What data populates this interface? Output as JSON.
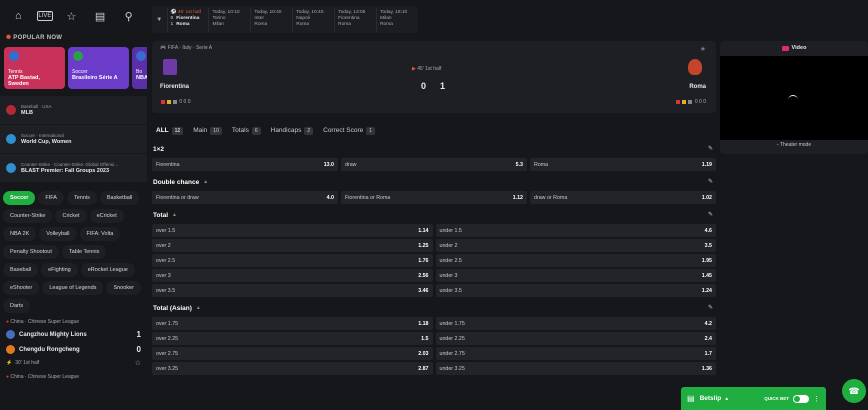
{
  "sidebar": {
    "popular_heading": "POPULAR NOW",
    "cards": [
      {
        "type": "Tennis",
        "name": "ATP Bastad, Sweden",
        "color": "#c8325a"
      },
      {
        "type": "Soccer",
        "name": "Brasileiro Série A",
        "color": "#6a3cc9"
      },
      {
        "type": "Bo",
        "name": "NBA",
        "color": "#5a2fa8"
      }
    ],
    "leagues": [
      {
        "sport": "Baseball · USA",
        "name": "MLB"
      },
      {
        "sport": "Soccer · International",
        "name": "World Cup, Women"
      },
      {
        "sport": "Counter-Strike · Counter-Strike: Global Offensi…",
        "name": "BLAST Premier: Fall Groups 2023"
      }
    ],
    "chips": [
      "Soccer",
      "FIFA",
      "Tennis",
      "Basketball",
      "Counter-Strike",
      "Cricket",
      "eCricket",
      "NBA 2K",
      "Volleyball",
      "FIFA: Volta",
      "Penalty Shootout",
      "Table Tennis",
      "Baseball",
      "eFighting",
      "eRocket League",
      "eShooter",
      "League of Legends",
      "Snooker",
      "Darts"
    ],
    "match": {
      "league": "China · Chinese Super League",
      "team1": "Cangzhou Mighty Lions",
      "score1": "1",
      "team2": "Chengdu Rongcheng",
      "score2": "0",
      "live": "30' 1st half",
      "next_league": "China · Chinese Super League"
    }
  },
  "topbar": {
    "matches": [
      {
        "time": "45' 1st half",
        "t1": "Fiorentina",
        "t2": "Roma",
        "s1": "0",
        "s2": "1",
        "live": true
      },
      {
        "time": "Today, 10:10",
        "t1": "Torino",
        "t2": "Milan",
        "live": false
      },
      {
        "time": "Today, 10:40",
        "t1": "Inter",
        "t2": "Roma",
        "live": false
      },
      {
        "time": "Today, 10:40",
        "t1": "Napoli",
        "t2": "Roma",
        "live": false
      },
      {
        "time": "Today, 13:05",
        "t1": "Fiorentina",
        "t2": "Roma",
        "live": false
      },
      {
        "time": "Today, 18:10",
        "t1": "Milan",
        "t2": "Roma",
        "live": false
      }
    ]
  },
  "hero": {
    "league": "FIFA · Italy · Serie A",
    "status": "45' 1st half",
    "team1": "Fiorentina",
    "team2": "Roma",
    "score1": "0",
    "score2": "1",
    "stats1": "0 0 0",
    "stats2": "0 0 0"
  },
  "tabs": [
    {
      "label": "ALL",
      "count": "12"
    },
    {
      "label": "Main",
      "count": "10"
    },
    {
      "label": "Totals",
      "count": "6"
    },
    {
      "label": "Handicaps",
      "count": "2"
    },
    {
      "label": "Correct Score",
      "count": "1"
    }
  ],
  "markets": {
    "m1x2": {
      "title": "1×2",
      "odds": [
        {
          "n": "Fiorentina",
          "v": "13.0"
        },
        {
          "n": "draw",
          "v": "5.3"
        },
        {
          "n": "Roma",
          "v": "1.19"
        }
      ]
    },
    "double": {
      "title": "Double chance",
      "odds": [
        {
          "n": "Fiorentina or draw",
          "v": "4.0"
        },
        {
          "n": "Fiorentina or Roma",
          "v": "1.12"
        },
        {
          "n": "draw or Roma",
          "v": "1.02"
        }
      ]
    },
    "total": {
      "title": "Total",
      "rows": [
        [
          {
            "n": "over 1.5",
            "v": "1.14"
          },
          {
            "n": "under 1.5",
            "v": "4.6"
          }
        ],
        [
          {
            "n": "over 2",
            "v": "1.25"
          },
          {
            "n": "under 2",
            "v": "3.5"
          }
        ],
        [
          {
            "n": "over 2.5",
            "v": "1.76"
          },
          {
            "n": "under 2.5",
            "v": "1.95"
          }
        ],
        [
          {
            "n": "over 3",
            "v": "2.56"
          },
          {
            "n": "under 3",
            "v": "1.45"
          }
        ],
        [
          {
            "n": "over 3.5",
            "v": "3.46"
          },
          {
            "n": "under 3.5",
            "v": "1.24"
          }
        ]
      ]
    },
    "asian": {
      "title": "Total (Asian)",
      "rows": [
        [
          {
            "n": "over 1.75",
            "v": "1.18"
          },
          {
            "n": "under 1.75",
            "v": "4.2"
          }
        ],
        [
          {
            "n": "over 2.25",
            "v": "1.5"
          },
          {
            "n": "under 2.25",
            "v": "2.4"
          }
        ],
        [
          {
            "n": "over 2.75",
            "v": "2.03"
          },
          {
            "n": "under 2.75",
            "v": "1.7"
          }
        ],
        [
          {
            "n": "over 3.25",
            "v": "2.87"
          },
          {
            "n": "under 3.25",
            "v": "1.36"
          }
        ]
      ]
    }
  },
  "video": {
    "title": "Video",
    "footer": "Theater mode"
  },
  "betslip": {
    "label": "Betslip",
    "quick": "QUICK BET"
  },
  "colors": {
    "accent": "#1fae3f",
    "live": "#e05b3a",
    "bg": "#16171b"
  }
}
